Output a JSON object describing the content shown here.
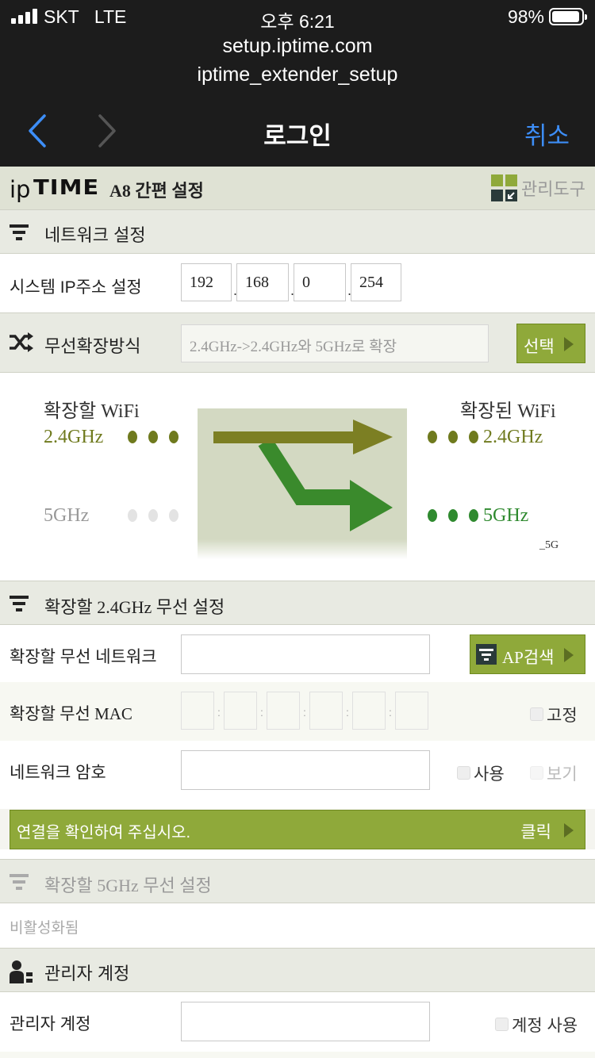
{
  "status_bar": {
    "carrier": "SKT",
    "network": "LTE",
    "time": "오후 6:21",
    "battery": "98%"
  },
  "browser": {
    "url": "setup.iptime.com",
    "subtitle": "iptime_extender_setup",
    "title": "로그인",
    "cancel": "취소"
  },
  "brand": {
    "logo_ip": "ip",
    "logo_time": "TIME",
    "subtitle": "A8 간편 설정",
    "tools_label": "관리도구"
  },
  "network_section": {
    "title": "네트워크 설정",
    "ip_label": "시스템 IP주소 설정",
    "ip": [
      "192",
      "168",
      "0",
      "254"
    ]
  },
  "mode": {
    "label": "무선확장방식",
    "value": "2.4GHz->2.4GHz와 5GHz로 확장",
    "button": "선택"
  },
  "diagram": {
    "left_title": "확장할 WiFi",
    "right_title": "확장된 WiFi",
    "left_24": "2.4GHz",
    "left_5": "5GHz",
    "right_24": "2.4GHz",
    "right_5": "5GHz",
    "suffix": "_5G"
  },
  "wifi24": {
    "title": "확장할 2.4GHz 무선 설정",
    "network_label": "확장할 무선 네트워크",
    "ap_button": "AP검색",
    "mac_label": "확장할 무선 MAC",
    "fixed_label": "고정",
    "password_label": "네트워크 암호",
    "use_label": "사용",
    "show_label": "보기",
    "confirm_text": "연결을 확인하여 주십시오.",
    "click_label": "클릭"
  },
  "wifi5": {
    "title": "확장할 5GHz 무선 설정",
    "status": "비활성화됨"
  },
  "admin": {
    "title": "관리자 계정",
    "account_label": "관리자 계정",
    "use_label": "계정 사용"
  },
  "colors": {
    "accent_green": "#8fa93a",
    "olive": "#6f7a1e",
    "dark_green": "#2f8a2f",
    "ios_blue": "#3d8ef7"
  }
}
